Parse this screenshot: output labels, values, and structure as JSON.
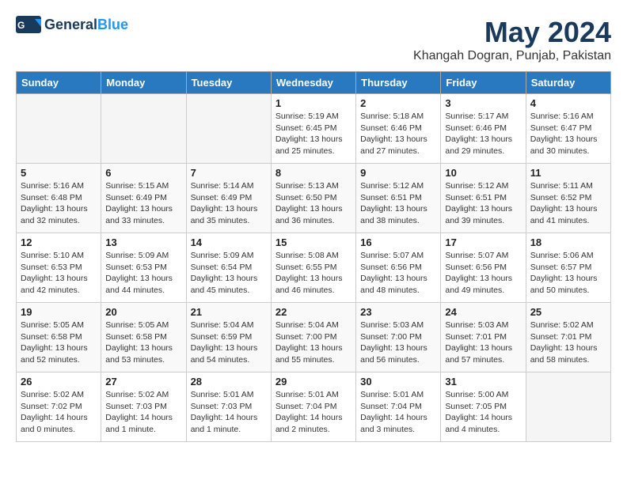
{
  "header": {
    "logo_general": "General",
    "logo_blue": "Blue",
    "month_title": "May 2024",
    "location": "Khangah Dogran, Punjab, Pakistan"
  },
  "weekdays": [
    "Sunday",
    "Monday",
    "Tuesday",
    "Wednesday",
    "Thursday",
    "Friday",
    "Saturday"
  ],
  "weeks": [
    [
      {
        "day": "",
        "empty": true
      },
      {
        "day": "",
        "empty": true
      },
      {
        "day": "",
        "empty": true
      },
      {
        "day": "1",
        "sunrise": "5:19 AM",
        "sunset": "6:45 PM",
        "daylight": "13 hours and 25 minutes."
      },
      {
        "day": "2",
        "sunrise": "5:18 AM",
        "sunset": "6:46 PM",
        "daylight": "13 hours and 27 minutes."
      },
      {
        "day": "3",
        "sunrise": "5:17 AM",
        "sunset": "6:46 PM",
        "daylight": "13 hours and 29 minutes."
      },
      {
        "day": "4",
        "sunrise": "5:16 AM",
        "sunset": "6:47 PM",
        "daylight": "13 hours and 30 minutes."
      }
    ],
    [
      {
        "day": "5",
        "sunrise": "5:16 AM",
        "sunset": "6:48 PM",
        "daylight": "13 hours and 32 minutes."
      },
      {
        "day": "6",
        "sunrise": "5:15 AM",
        "sunset": "6:49 PM",
        "daylight": "13 hours and 33 minutes."
      },
      {
        "day": "7",
        "sunrise": "5:14 AM",
        "sunset": "6:49 PM",
        "daylight": "13 hours and 35 minutes."
      },
      {
        "day": "8",
        "sunrise": "5:13 AM",
        "sunset": "6:50 PM",
        "daylight": "13 hours and 36 minutes."
      },
      {
        "day": "9",
        "sunrise": "5:12 AM",
        "sunset": "6:51 PM",
        "daylight": "13 hours and 38 minutes."
      },
      {
        "day": "10",
        "sunrise": "5:12 AM",
        "sunset": "6:51 PM",
        "daylight": "13 hours and 39 minutes."
      },
      {
        "day": "11",
        "sunrise": "5:11 AM",
        "sunset": "6:52 PM",
        "daylight": "13 hours and 41 minutes."
      }
    ],
    [
      {
        "day": "12",
        "sunrise": "5:10 AM",
        "sunset": "6:53 PM",
        "daylight": "13 hours and 42 minutes."
      },
      {
        "day": "13",
        "sunrise": "5:09 AM",
        "sunset": "6:53 PM",
        "daylight": "13 hours and 44 minutes."
      },
      {
        "day": "14",
        "sunrise": "5:09 AM",
        "sunset": "6:54 PM",
        "daylight": "13 hours and 45 minutes."
      },
      {
        "day": "15",
        "sunrise": "5:08 AM",
        "sunset": "6:55 PM",
        "daylight": "13 hours and 46 minutes."
      },
      {
        "day": "16",
        "sunrise": "5:07 AM",
        "sunset": "6:56 PM",
        "daylight": "13 hours and 48 minutes."
      },
      {
        "day": "17",
        "sunrise": "5:07 AM",
        "sunset": "6:56 PM",
        "daylight": "13 hours and 49 minutes."
      },
      {
        "day": "18",
        "sunrise": "5:06 AM",
        "sunset": "6:57 PM",
        "daylight": "13 hours and 50 minutes."
      }
    ],
    [
      {
        "day": "19",
        "sunrise": "5:05 AM",
        "sunset": "6:58 PM",
        "daylight": "13 hours and 52 minutes."
      },
      {
        "day": "20",
        "sunrise": "5:05 AM",
        "sunset": "6:58 PM",
        "daylight": "13 hours and 53 minutes."
      },
      {
        "day": "21",
        "sunrise": "5:04 AM",
        "sunset": "6:59 PM",
        "daylight": "13 hours and 54 minutes."
      },
      {
        "day": "22",
        "sunrise": "5:04 AM",
        "sunset": "7:00 PM",
        "daylight": "13 hours and 55 minutes."
      },
      {
        "day": "23",
        "sunrise": "5:03 AM",
        "sunset": "7:00 PM",
        "daylight": "13 hours and 56 minutes."
      },
      {
        "day": "24",
        "sunrise": "5:03 AM",
        "sunset": "7:01 PM",
        "daylight": "13 hours and 57 minutes."
      },
      {
        "day": "25",
        "sunrise": "5:02 AM",
        "sunset": "7:01 PM",
        "daylight": "13 hours and 58 minutes."
      }
    ],
    [
      {
        "day": "26",
        "sunrise": "5:02 AM",
        "sunset": "7:02 PM",
        "daylight": "14 hours and 0 minutes."
      },
      {
        "day": "27",
        "sunrise": "5:02 AM",
        "sunset": "7:03 PM",
        "daylight": "14 hours and 1 minute."
      },
      {
        "day": "28",
        "sunrise": "5:01 AM",
        "sunset": "7:03 PM",
        "daylight": "14 hours and 1 minute."
      },
      {
        "day": "29",
        "sunrise": "5:01 AM",
        "sunset": "7:04 PM",
        "daylight": "14 hours and 2 minutes."
      },
      {
        "day": "30",
        "sunrise": "5:01 AM",
        "sunset": "7:04 PM",
        "daylight": "14 hours and 3 minutes."
      },
      {
        "day": "31",
        "sunrise": "5:00 AM",
        "sunset": "7:05 PM",
        "daylight": "14 hours and 4 minutes."
      },
      {
        "day": "",
        "empty": true
      }
    ]
  ]
}
